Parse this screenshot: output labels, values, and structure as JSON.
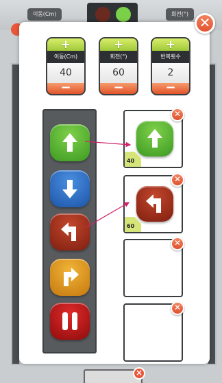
{
  "background": {
    "move_chip": "이동(Cm)",
    "turn_chip": "회전(°)"
  },
  "modal": {
    "close_symbol": "✕",
    "steppers": [
      {
        "plus": "+",
        "label": "이동(Cm)",
        "value": "40",
        "minus": "−"
      },
      {
        "plus": "+",
        "label": "회전(°)",
        "value": "60",
        "minus": "−"
      },
      {
        "plus": "+",
        "label": "반복횟수",
        "value": "2",
        "minus": "−"
      }
    ],
    "palette": [
      {
        "icon": "arrow-up-icon",
        "color": "#3c9a22"
      },
      {
        "icon": "arrow-down-icon",
        "color": "#1d55a8"
      },
      {
        "icon": "turn-left-icon",
        "color": "#7f1f10"
      },
      {
        "icon": "turn-right-icon",
        "color": "#c6780f"
      },
      {
        "icon": "pause-icon",
        "color": "#8f0c0c"
      }
    ],
    "slots": [
      {
        "command_icon": "arrow-up-icon",
        "tag": "40",
        "remove_symbol": "✕"
      },
      {
        "command_icon": "turn-left-icon",
        "tag": "60",
        "remove_symbol": "✕"
      },
      {
        "command_icon": "",
        "tag": "",
        "remove_symbol": "✕"
      },
      {
        "command_icon": "",
        "tag": "",
        "remove_symbol": "✕"
      }
    ]
  },
  "colors": {
    "accent_plus": "#9fc83a",
    "accent_minus": "#e2542a",
    "connector": "#d0246a"
  }
}
